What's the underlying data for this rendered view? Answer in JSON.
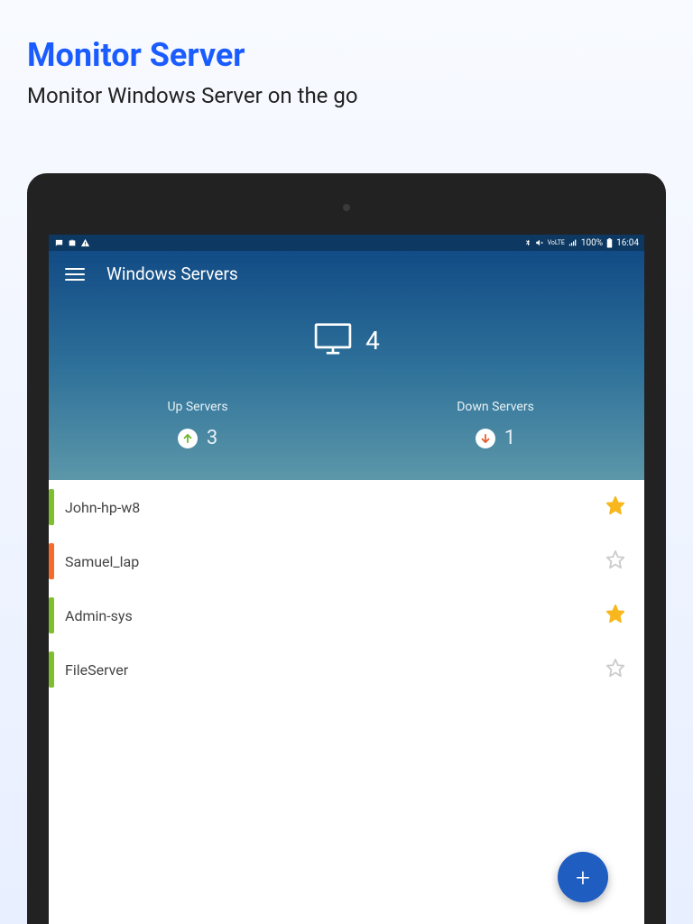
{
  "promo": {
    "title": "Monitor Server",
    "subtitle": "Monitor Windows Server on the go"
  },
  "statusbar": {
    "battery_text": "100%",
    "time": "16:04"
  },
  "appbar": {
    "title": "Windows Servers"
  },
  "hero": {
    "total_count": "4"
  },
  "stats": {
    "up": {
      "label": "Up Servers",
      "value": "3"
    },
    "down": {
      "label": "Down Servers",
      "value": "1"
    }
  },
  "servers": [
    {
      "name": "John-hp-w8",
      "status": "up",
      "starred": true
    },
    {
      "name": "Samuel_lap",
      "status": "down",
      "starred": false
    },
    {
      "name": "Admin-sys",
      "status": "up",
      "starred": true
    },
    {
      "name": "FileServer",
      "status": "up",
      "starred": false
    }
  ],
  "colors": {
    "accent": "#1a5cff",
    "up_green": "#7fbf2f",
    "down_orange": "#f56b2a",
    "star_on": "#f8b71c",
    "star_off": "#cccccc",
    "fab": "#1f5dc1"
  }
}
